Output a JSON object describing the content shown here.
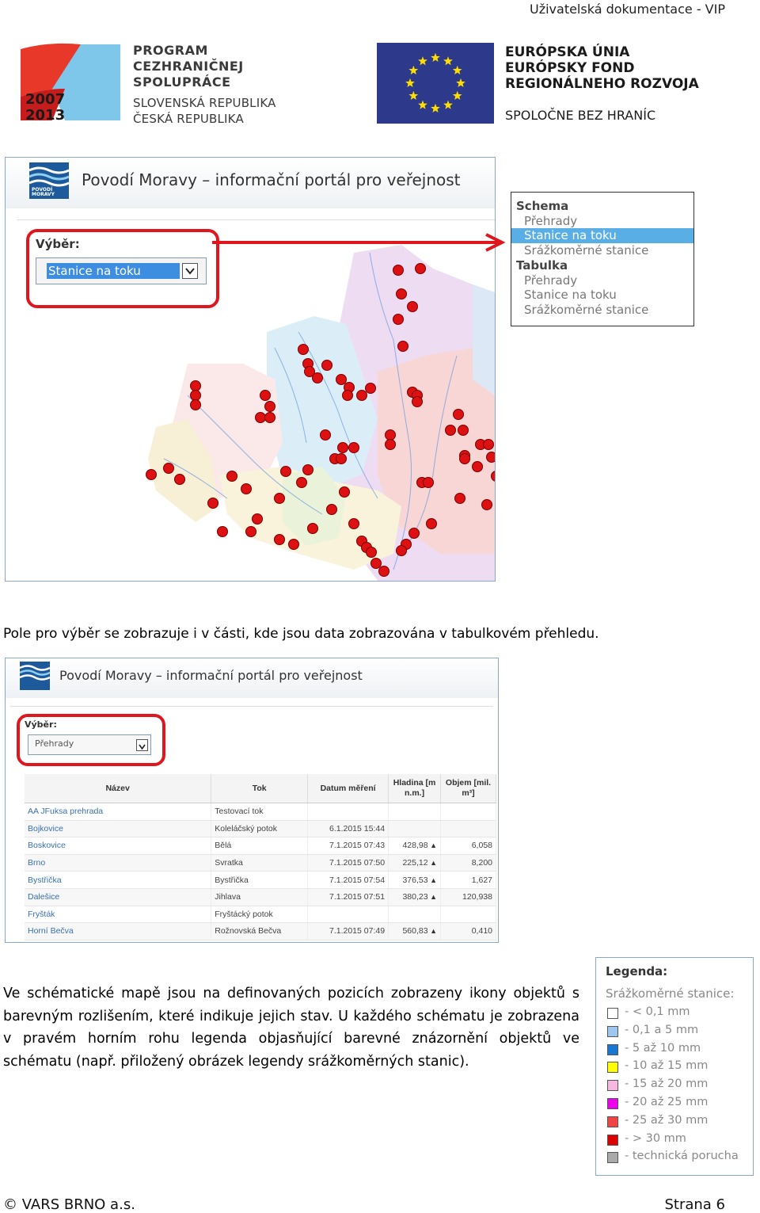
{
  "header": {
    "doc_title": "Uživatelská dokumentace - VIP"
  },
  "logos": {
    "program": {
      "years_top": "2007",
      "years_bottom": "2013",
      "line1": "PROGRAM",
      "line2": "CEZHRANIČNEJ",
      "line3": "SPOLUPRÁCE",
      "line4": "SLOVENSKÁ REPUBLIKA",
      "line5": "ČESKÁ REPUBLIKA"
    },
    "eu": {
      "line1": "EURÓPSKA ÚNIA",
      "line2": "EURÓPSKY FOND",
      "line3": "REGIONÁLNEHO ROZVOJA",
      "motto": "SPOLOČNE BEZ HRANÍC"
    }
  },
  "portal": {
    "title": "Povodí Moravy – informační portál pro veřejnost",
    "logo_line1": "POVODÍ",
    "logo_line2": "MORAVY"
  },
  "screenshot1": {
    "select_label": "Výběr:",
    "select_value": "Stanice na toku",
    "dropdown": [
      {
        "label": "Schema",
        "kind": "head"
      },
      {
        "label": "Přehrady",
        "kind": "item"
      },
      {
        "label": "Stanice na toku",
        "kind": "selected"
      },
      {
        "label": "Srážkoměrné stanice",
        "kind": "item"
      },
      {
        "label": "Tabulka",
        "kind": "head"
      },
      {
        "label": "Přehrady",
        "kind": "item"
      },
      {
        "label": "Stanice na toku",
        "kind": "item"
      },
      {
        "label": "Srážkoměrné stanice",
        "kind": "item"
      }
    ]
  },
  "paragraph1": "Pole pro výběr se zobrazuje i v části, kde jsou data zobrazována v tabulkovém přehledu.",
  "screenshot2": {
    "select_label": "Výběr:",
    "select_value": "Přehrady",
    "columns": [
      "Název",
      "Tok",
      "Datum měření",
      "Hladina [m n.m.]",
      "Objem [mil. m³]"
    ],
    "rows": [
      [
        "AA JFuksa prehrada",
        "Testovací tok",
        "",
        "",
        ""
      ],
      [
        "Bojkovice",
        "Koleláčský potok",
        "6.1.2015 15:44",
        "",
        ""
      ],
      [
        "Boskovice",
        "Bělá",
        "7.1.2015 07:43",
        "428,98",
        "6,058"
      ],
      [
        "Brno",
        "Svratka",
        "7.1.2015 07:50",
        "225,12",
        "8,200"
      ],
      [
        "Bystřička",
        "Bystřička",
        "7.1.2015 07:54",
        "376,53",
        "1,627"
      ],
      [
        "Dalešice",
        "Jihlava",
        "7.1.2015 07:51",
        "380,23",
        "120,938"
      ],
      [
        "Fryšták",
        "Fryštácký potok",
        "",
        "",
        ""
      ],
      [
        "Horní Bečva",
        "Rožnovská Bečva",
        "7.1.2015 07:49",
        "560,83",
        "0,410"
      ]
    ]
  },
  "paragraph2": "Ve schématické mapě jsou na definovaných pozicích zobrazeny ikony objektů s barevným rozlišením, které indikuje jejich stav. U každého schématu je zobrazena v pravém horním rohu legenda objasňující barevné znázornění objektů ve schématu (např. přiložený obrázek legendy srážkoměrných stanic).",
  "legend": {
    "title": "Legenda:",
    "subtitle": "Srážkoměrné stanice:",
    "items": [
      {
        "label": "- < 0,1 mm",
        "color": "#ffffff"
      },
      {
        "label": "- 0,1 a 5 mm",
        "color": "#9fc6ee"
      },
      {
        "label": "- 5 až 10 mm",
        "color": "#1976d2"
      },
      {
        "label": "- 10 až 15 mm",
        "color": "#ffff00"
      },
      {
        "label": "- 15 až 20 mm",
        "color": "#f7b8e0"
      },
      {
        "label": "- 20 až 25 mm",
        "color": "#ee00ee"
      },
      {
        "label": "- 25 až 30 mm",
        "color": "#ee4444"
      },
      {
        "label": "- > 30 mm",
        "color": "#dd0000"
      },
      {
        "label": "- technická porucha",
        "color": "#aaaaaa"
      }
    ]
  },
  "footer": {
    "company": "© VARS BRNO a.s.",
    "page": "Strana 6"
  }
}
